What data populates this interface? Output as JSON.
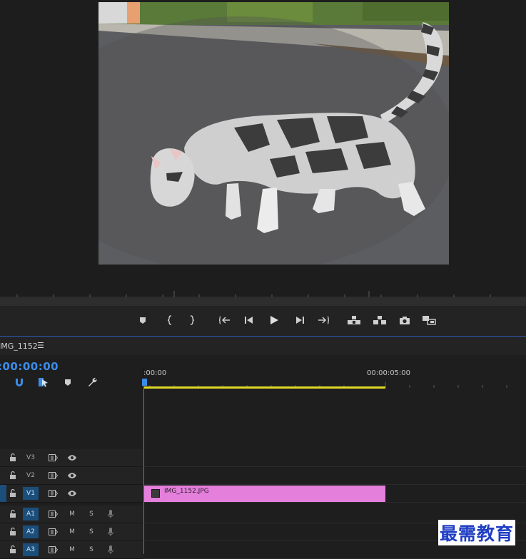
{
  "sequence": {
    "title": "IMG_1152",
    "menu_glyph": "☰",
    "timecode": ":00:00:00"
  },
  "ruler": {
    "start_label": ":00:00",
    "mid_label": "00:00:05:00"
  },
  "clip": {
    "label": "IMG_1152.JPG",
    "color": "#e47fdc"
  },
  "tracks": {
    "video": [
      {
        "name": "V3"
      },
      {
        "name": "V2"
      },
      {
        "name": "V1"
      }
    ],
    "audio": [
      {
        "name": "A1",
        "m": "M",
        "s": "S"
      },
      {
        "name": "A2",
        "m": "M",
        "s": "S"
      },
      {
        "name": "A3",
        "m": "M",
        "s": "S"
      }
    ]
  },
  "transport_icons": [
    "marker-icon",
    "mark-in-icon",
    "mark-out-icon",
    "go-to-in-icon",
    "step-back-icon",
    "play-icon",
    "step-forward-icon",
    "go-to-out-icon",
    "lift-icon",
    "extract-icon",
    "export-frame-icon",
    "compare-view-icon"
  ],
  "timeline_tools": [
    "snap-icon",
    "linked-selection-icon",
    "add-marker-icon",
    "wrench-icon"
  ],
  "colors": {
    "accent": "#3b8ce8",
    "track_target": "#1b4e7a",
    "work_area": "#e0d826"
  },
  "watermark": "最需教育"
}
